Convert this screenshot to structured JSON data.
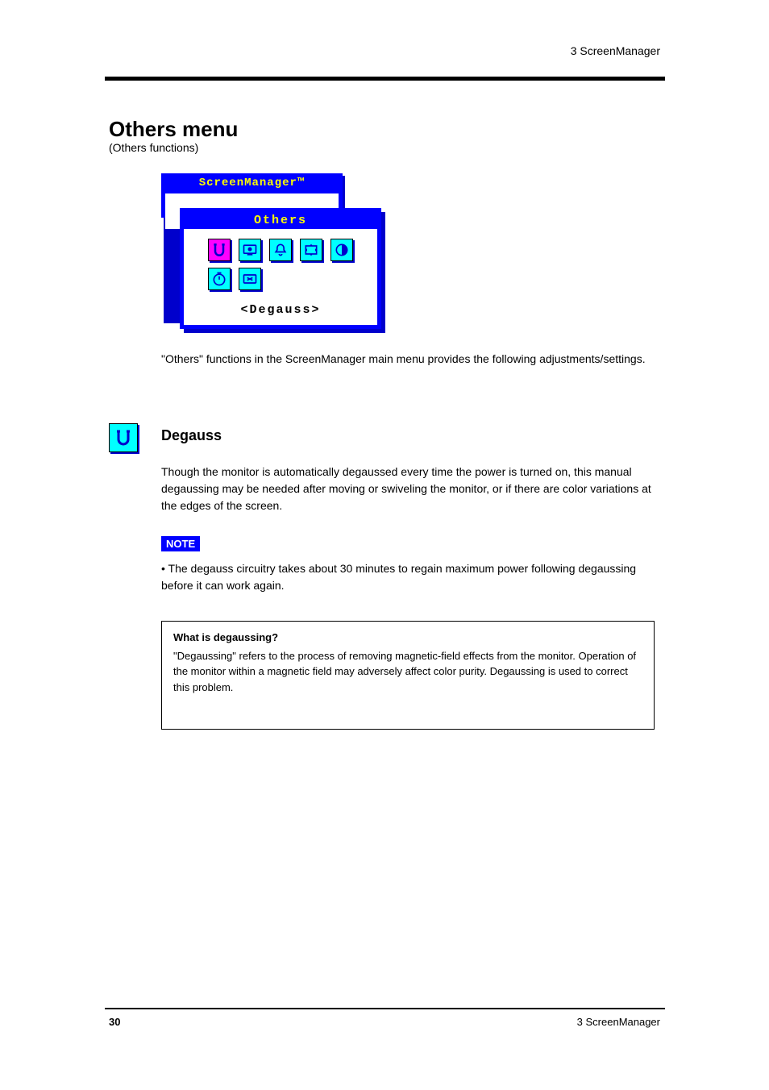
{
  "header": {
    "right": "3 ScreenManager"
  },
  "section": {
    "title": "Others menu",
    "subtitle": "(Others functions)"
  },
  "osd": {
    "main_title": "ScreenManager™",
    "sub_title": "Others",
    "selected_label": "<Degauss>",
    "icons": [
      {
        "name": "degauss-icon"
      },
      {
        "name": "power-save-icon"
      },
      {
        "name": "beep-icon"
      },
      {
        "name": "menu-position-icon"
      },
      {
        "name": "contrast-icon"
      },
      {
        "name": "off-timer-icon"
      },
      {
        "name": "reset-icon"
      }
    ]
  },
  "intro": "\"Others\" functions in the ScreenManager main menu provides the following adjustments/settings.",
  "degauss": {
    "title": "Degauss",
    "body": "Though the monitor is automatically degaussed every time the power is turned on, this manual degaussing may be needed after moving or swiveling the monitor, or if there are color variations at the edges of the screen.",
    "note_label": "NOTE",
    "note_body": "The degauss circuitry takes about 30 minutes to regain maximum power following degaussing before it can work again.",
    "what_title": "What is degaussing?",
    "what_body": "\"Degaussing\" refers to the process of removing magnetic-field effects from the monitor. Operation of the monitor within a magnetic field may adversely affect color purity. Degaussing is used to correct this problem."
  },
  "footer": {
    "left": "30",
    "right": "3 ScreenManager"
  }
}
